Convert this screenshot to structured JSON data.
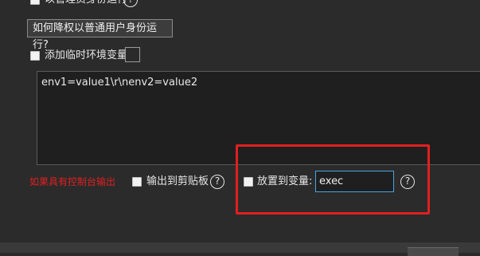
{
  "top": {
    "run_as_admin_label": "以管理员身份运行",
    "help_glyph": "?"
  },
  "downgrade_button_label": "如何降权以普通用户身份运行?",
  "temp_env": {
    "label": "添加临时环境变量",
    "textarea_value": "env1=value1\\r\\nenv2=value2"
  },
  "bottom_row": {
    "console_note": "如果具有控制台输出",
    "clipboard_label": "输出到剪贴板",
    "variable_label": "放置到变量:",
    "variable_value": "exec",
    "help_glyph": "?"
  },
  "colors": {
    "note_red": "#e02020",
    "highlight_box": "#e02020",
    "focus_border": "#4aa3e0"
  }
}
